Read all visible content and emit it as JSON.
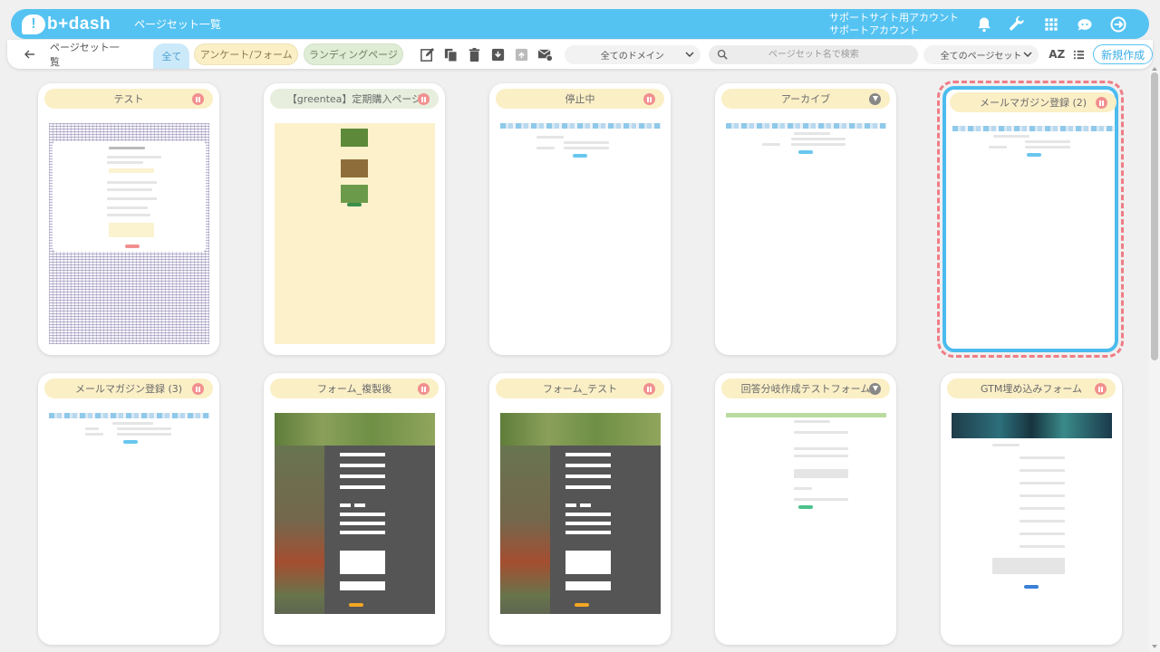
{
  "header": {
    "logo_mark": "!",
    "logo_text": "b+dash",
    "title": "ページセット一覧",
    "account_line1": "サポートサイト用アカウント",
    "account_line2": "サポートアカウント",
    "icons": [
      "bell-icon",
      "wrench-icon",
      "apps-grid-icon",
      "chat-bot-icon",
      "logout-icon"
    ]
  },
  "toolbar": {
    "breadcrumb": "ページセット一覧",
    "tabs": [
      {
        "label": "全て",
        "active": true
      },
      {
        "label": "アンケート/フォーム",
        "active": false
      },
      {
        "label": "ランディングページ",
        "active": false
      }
    ],
    "action_icons": [
      "edit-icon",
      "copy-icon",
      "trash-icon",
      "archive-icon",
      "unarchive-icon",
      "mail-settings-icon"
    ],
    "domain_select": "全てのドメイン",
    "search_placeholder": "ページセット名で検索",
    "pageset_select": "全てのページセット",
    "sort_label": "AZ",
    "new_button": "新規作成"
  },
  "cards": [
    {
      "title": "テスト",
      "status": "paused",
      "thumb": "survey-grid"
    },
    {
      "title": "【greentea】定期購入ページ",
      "status": "paused",
      "thumb": "greentea"
    },
    {
      "title": "停止中",
      "status": "paused",
      "thumb": "simple-form"
    },
    {
      "title": "アーカイブ",
      "status": "archived",
      "thumb": "simple-form"
    },
    {
      "title": "メールマガジン登録 (2)",
      "status": "paused",
      "thumb": "simple-form",
      "selected": true
    },
    {
      "title": "メールマガジン登録 (3)",
      "status": "paused",
      "thumb": "simple-form"
    },
    {
      "title": "フォーム_複製後",
      "status": "paused",
      "thumb": "veg-form"
    },
    {
      "title": "フォーム_テスト",
      "status": "paused",
      "thumb": "veg-form"
    },
    {
      "title": "回答分岐作成テストフォーム",
      "status": "archived",
      "thumb": "branch-form"
    },
    {
      "title": "GTM埋め込みフォーム",
      "status": "paused",
      "thumb": "gtm-form"
    }
  ],
  "colors": {
    "brand": "#55c3f2",
    "card_title_bg": "#fbefc6",
    "pause_badge": "#f28f8f",
    "selected_outline": "#4cbcee",
    "selected_dash": "#ef7d86"
  }
}
